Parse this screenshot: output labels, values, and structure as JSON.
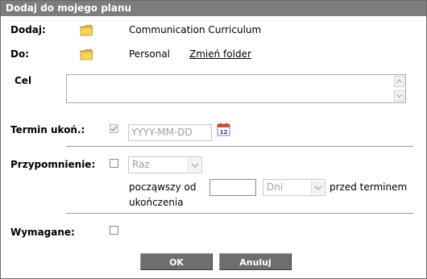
{
  "dialog": {
    "title": "Dodaj do mojego planu"
  },
  "add": {
    "label": "Dodaj:",
    "icon": "folder-icon",
    "value": "Communication Curriculum"
  },
  "destination": {
    "label": "Do:",
    "icon": "folder-icon",
    "value": "Personal",
    "change_link": "Zmień folder"
  },
  "goal": {
    "label": "Cel",
    "value": ""
  },
  "due_date": {
    "label": "Termin ukoń.:",
    "checked": true,
    "disabled": true,
    "placeholder": "YYYY-MM-DD",
    "calendar_icon": "calendar-icon",
    "calendar_text": "12"
  },
  "reminder": {
    "label": "Przypomnienie:",
    "checked": false,
    "frequency": "Raz",
    "starting_label": "począwszy od",
    "offset_value": "",
    "unit": "Dni",
    "before_label_1": "przed terminem",
    "before_label_2": "ukończenia"
  },
  "required": {
    "label": "Wymagane:",
    "checked": false
  },
  "buttons": {
    "ok": "OK",
    "cancel": "Anuluj"
  },
  "colors": {
    "titlebar": "#7d7d7d",
    "button": "#6e6e6e",
    "folder": "#f2c94c"
  }
}
